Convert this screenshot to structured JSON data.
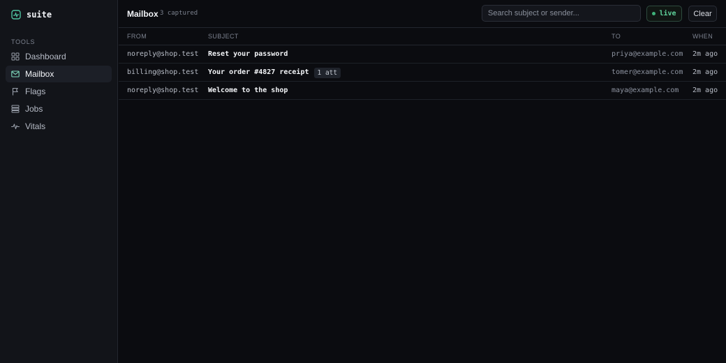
{
  "brand": {
    "name": "suite",
    "accent": "#4fc3a1"
  },
  "sidebar": {
    "section": "TOOLS",
    "items": [
      {
        "label": "Dashboard",
        "icon": "grid-icon",
        "active": false
      },
      {
        "label": "Mailbox",
        "icon": "mail-icon",
        "active": true
      },
      {
        "label": "Flags",
        "icon": "flag-icon",
        "active": false
      },
      {
        "label": "Jobs",
        "icon": "layers-icon",
        "active": false
      },
      {
        "label": "Vitals",
        "icon": "pulse-icon",
        "active": false
      }
    ]
  },
  "header": {
    "title": "Mailbox",
    "count": "3 captured",
    "search_placeholder": "Search subject or sender...",
    "live_label": "live",
    "clear_label": "Clear"
  },
  "table": {
    "columns": [
      "FROM",
      "SUBJECT",
      "TO",
      "WHEN"
    ],
    "rows": [
      {
        "from": "noreply@shop.test",
        "subject": "Reset your password",
        "attachments": "",
        "to": "priya@example.com",
        "when": "2m ago"
      },
      {
        "from": "billing@shop.test",
        "subject": "Your order #4827 receipt",
        "attachments": "1 att",
        "to": "tomer@example.com",
        "when": "2m ago"
      },
      {
        "from": "noreply@shop.test",
        "subject": "Welcome to the shop",
        "attachments": "",
        "to": "maya@example.com",
        "when": "2m ago"
      }
    ]
  }
}
